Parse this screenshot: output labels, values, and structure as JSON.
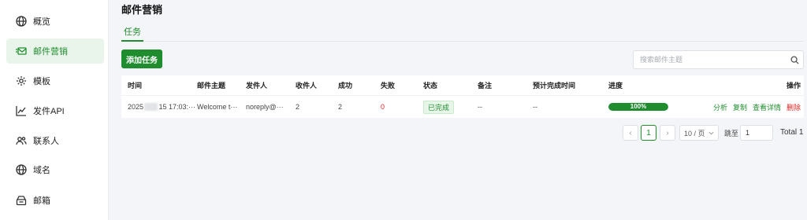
{
  "sidebar": {
    "items": [
      {
        "label": "概览",
        "icon": "globe-icon",
        "active": false
      },
      {
        "label": "邮件营销",
        "icon": "mail-icon",
        "active": true
      },
      {
        "label": "模板",
        "icon": "gear-icon",
        "active": false
      },
      {
        "label": "发件API",
        "icon": "chart-line-icon",
        "active": false
      },
      {
        "label": "联系人",
        "icon": "contacts-icon",
        "active": false
      },
      {
        "label": "域名",
        "icon": "globe-icon",
        "active": false
      },
      {
        "label": "邮箱",
        "icon": "mailbox-icon",
        "active": false
      }
    ]
  },
  "page": {
    "title": "邮件营销",
    "tabs": [
      {
        "label": "任务",
        "active": true
      }
    ],
    "add_button": "添加任务",
    "search_placeholder": "搜索邮件主题"
  },
  "table": {
    "columns": [
      "时间",
      "邮件主题",
      "发件人",
      "收件人",
      "成功",
      "失败",
      "状态",
      "备注",
      "预计完成时间",
      "进度",
      "操作"
    ],
    "rows": [
      {
        "time_prefix": "2025",
        "time_suffix": "15 17:03:···",
        "subject": "Welcome t···",
        "sender": "noreply@···",
        "recipients": "2",
        "success": "2",
        "failed": "0",
        "status": "已完成",
        "note": "--",
        "eta": "--",
        "progress_value": 100,
        "progress_label": "100%",
        "actions": [
          "分析",
          "复制",
          "查看详情",
          "删除"
        ]
      }
    ]
  },
  "pagination": {
    "prev": "‹",
    "current_page": "1",
    "next": "›",
    "page_size": "10 / 页",
    "jump_label": "跳至",
    "jump_value": "1",
    "total": "Total 1"
  },
  "colors": {
    "accent": "#1f8d2e",
    "danger": "#e02424",
    "background": "#f3f5f8"
  }
}
